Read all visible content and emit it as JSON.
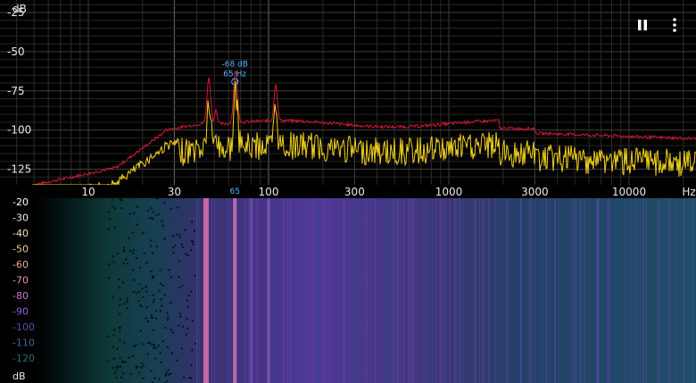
{
  "spectrum": {
    "db_unit": "dB",
    "db_ticks": [
      "-25",
      "-50",
      "-75",
      "-100",
      "-125"
    ],
    "db_values": [
      -25,
      -50,
      -75,
      -100,
      -125
    ],
    "freq_ticks": [
      "10",
      "30",
      "100",
      "300",
      "1000",
      "3000",
      "10000"
    ],
    "freq_values": [
      10,
      30,
      100,
      300,
      1000,
      3000,
      10000
    ],
    "freq_unit": "Hz",
    "marker": {
      "db_text": "-68 dB",
      "freq_text": "65 Hz",
      "axis_text": "65",
      "freq": 65,
      "db": -68
    },
    "colors": {
      "peak_trace": "#d01838",
      "live_trace": "#f2d21a",
      "marker": "#4fb6ff",
      "grid": "#3a3a3a"
    }
  },
  "spectrogram": {
    "db_unit": "dB",
    "colorbar_ticks": [
      "-20",
      "-30",
      "-40",
      "-50",
      "-60",
      "-70",
      "-80",
      "-90",
      "-100",
      "-110",
      "-120"
    ],
    "colorbar_colors": [
      "#ffffff",
      "#f4f0e8",
      "#f4e0c0",
      "#f4c890",
      "#f0a890",
      "#e890b0",
      "#c878d0",
      "#8c5ed0",
      "#5a52b0",
      "#3c6890",
      "#2a6a70"
    ]
  },
  "controls": {
    "pause_icon": "pause-icon",
    "menu_icon": "more-vertical-icon"
  }
}
